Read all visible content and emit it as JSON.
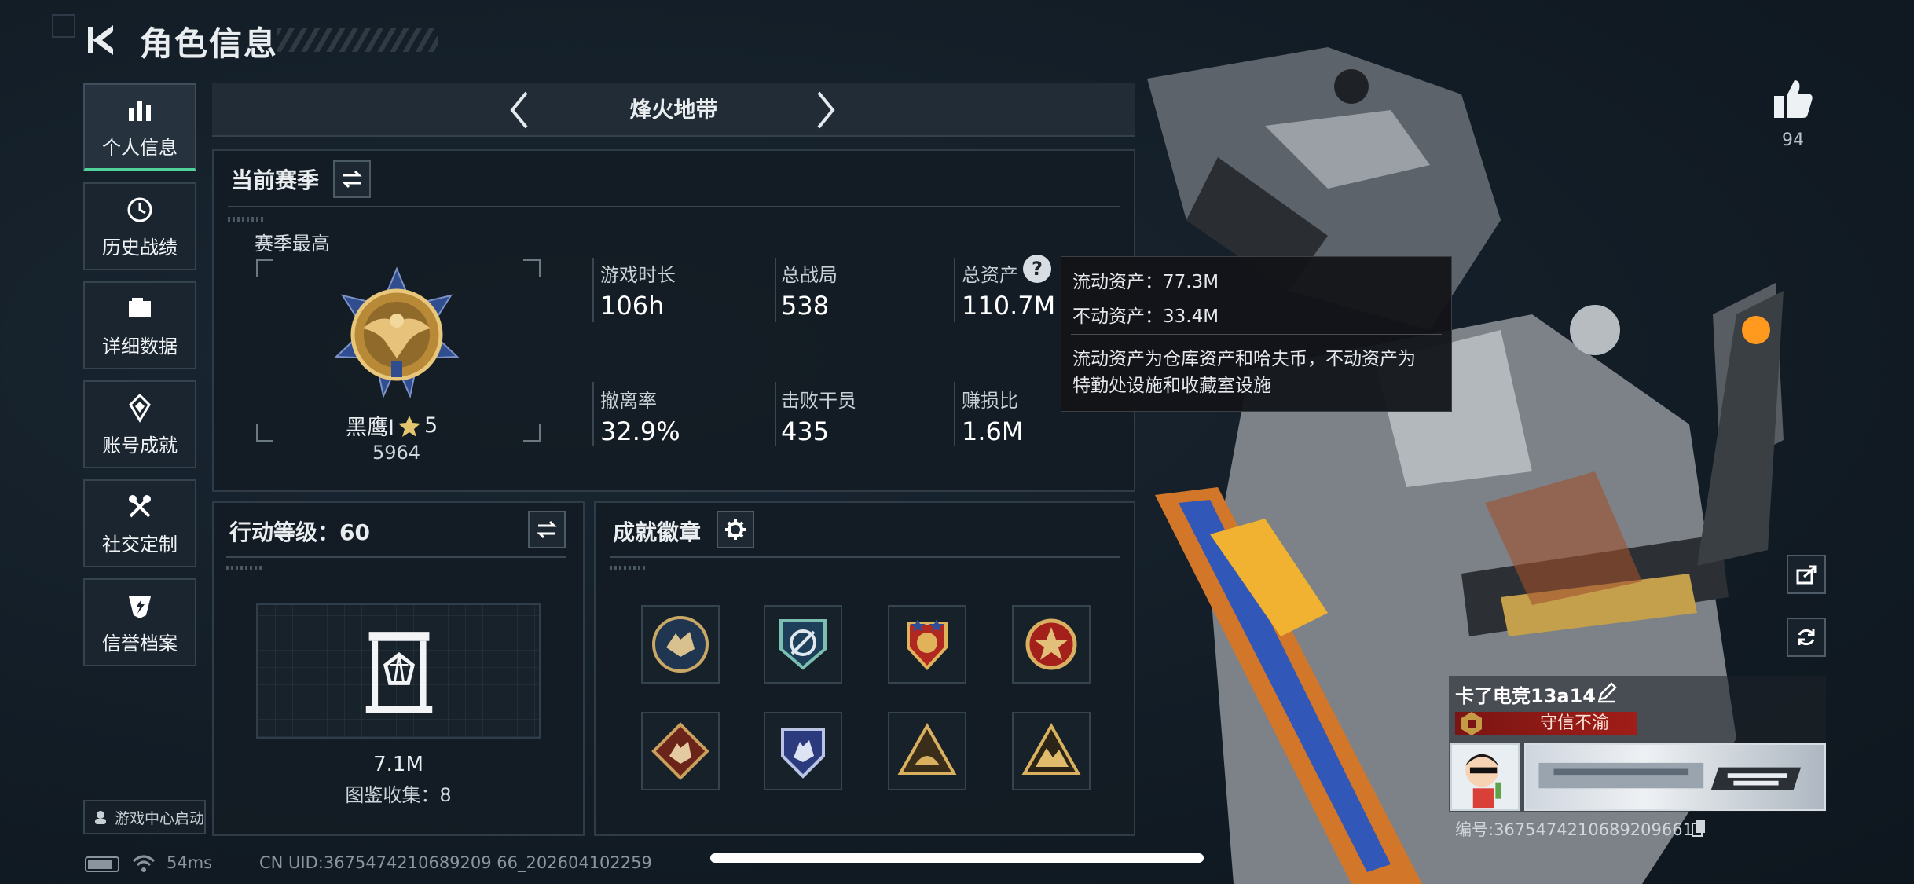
{
  "header": {
    "title": "角色信息"
  },
  "nav": {
    "items": [
      {
        "label": "个人信息",
        "icon": "bar-chart-icon",
        "active": true
      },
      {
        "label": "历史战绩",
        "icon": "history-clock-icon",
        "active": false
      },
      {
        "label": "详细数据",
        "icon": "folder-icon",
        "active": false
      },
      {
        "label": "账号成就",
        "icon": "medal-icon",
        "active": false
      },
      {
        "label": "社交定制",
        "icon": "tools-icon",
        "active": false
      },
      {
        "label": "信誉档案",
        "icon": "shield-bolt-icon",
        "active": false
      }
    ],
    "launch_label": "游戏中心启动"
  },
  "mode": {
    "label": "烽火地带"
  },
  "season": {
    "title": "当前赛季",
    "best_label": "赛季最高",
    "rank_name": "黑鹰I",
    "rank_stars": "5",
    "rank_points": "5964",
    "stats": [
      {
        "label": "游戏时长",
        "value": "106h"
      },
      {
        "label": "总战局",
        "value": "538"
      },
      {
        "label": "总资产",
        "value": "110.7M"
      },
      {
        "label": "撤离率",
        "value": "32.9%"
      },
      {
        "label": "击败干员",
        "value": "435"
      },
      {
        "label": "赚损比",
        "value": "1.6M"
      }
    ]
  },
  "tooltip": {
    "liquid": "流动资产：77.3M",
    "fixed": "不动资产：33.4M",
    "desc_line1": "流动资产为仓库资产和哈夫币，不动资产为",
    "desc_line2": "特勤处设施和收藏室设施"
  },
  "action_level": {
    "title": "行动等级：60",
    "value": "7.1M",
    "collection": "图鉴收集：8"
  },
  "achievements": {
    "title": "成就徽章",
    "badges": [
      "wolf-badge-icon",
      "arrows-badge-icon",
      "shield-star-badge-icon",
      "red-star-badge-icon",
      "diamond-wolf-badge-icon",
      "blue-shield-badge-icon",
      "triangle-badge-icon",
      "mountain-badge-icon"
    ]
  },
  "profile": {
    "likes": "94",
    "name": "卡了电竞13a14",
    "reputation": "守信不渝",
    "id": "编号:3675474210689209661"
  },
  "status": {
    "ping": "54ms",
    "uid": "CN UID:3675474210689209 66_202604102259"
  }
}
